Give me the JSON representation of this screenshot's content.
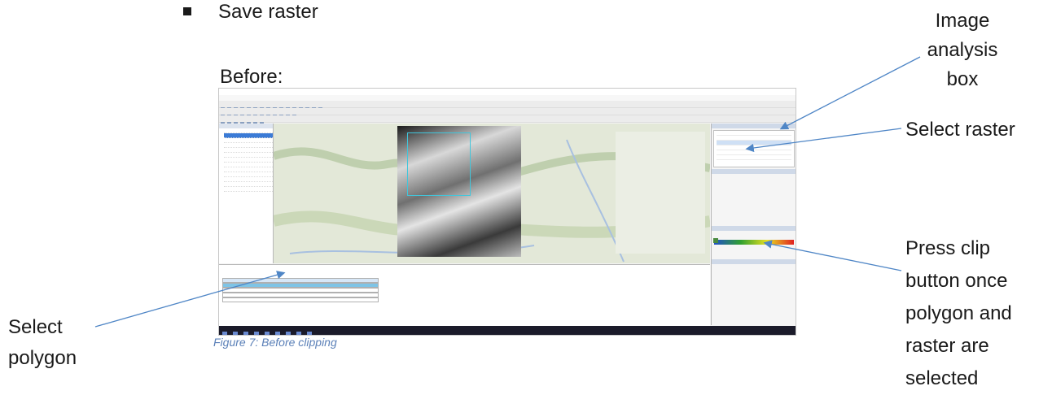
{
  "bullet": {
    "text": "Save raster"
  },
  "before_label": "Before:",
  "caption": "Figure 7: Before clipping",
  "annotations": {
    "image_analysis_box": "Image analysis box",
    "select_raster": "Select raster",
    "press_clip": "Press clip button once polygon and raster are selected",
    "select_polygon": "Select polygon"
  },
  "colors": {
    "caption": "#5b80b8",
    "arrow": "#4f86c6",
    "clip_extent": "#41c6dc"
  }
}
